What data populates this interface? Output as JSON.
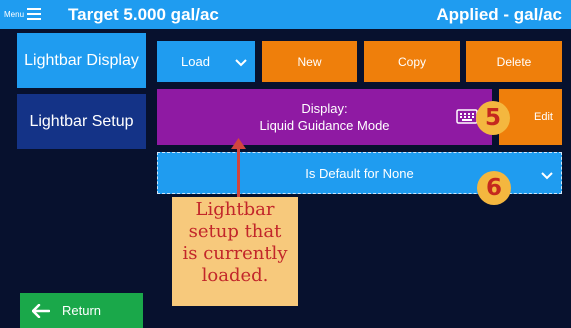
{
  "header": {
    "menu_label": "Menu",
    "target": "Target 5.000 gal/ac",
    "applied": "Applied - gal/ac"
  },
  "sidebar": {
    "items": [
      {
        "label": "Lightbar Display",
        "active": true
      },
      {
        "label": "Lightbar Setup",
        "active": false
      }
    ],
    "return_label": "Return"
  },
  "toolbar": {
    "load_label": "Load",
    "new_label": "New",
    "copy_label": "Copy",
    "delete_label": "Delete"
  },
  "display": {
    "title": "Display:",
    "mode": "Liquid Guidance Mode",
    "edit_label": "Edit"
  },
  "default_select": {
    "value": "Is Default for None"
  },
  "badges": {
    "five": "5",
    "six": "6"
  },
  "annotation": {
    "lines": [
      "Lightbar",
      "setup that",
      "is currently",
      "loaded."
    ]
  },
  "colors": {
    "background": "#07112e",
    "header": "#1f9cf0",
    "primary_blue": "#1f9cf0",
    "dark_blue": "#143387",
    "orange": "#ef7f0b",
    "purple": "#8f1aa3",
    "green": "#1aa84a",
    "badge": "#f4b73f",
    "annotation_fill": "#f7c97c",
    "annotation_text": "#c2262a"
  },
  "icons": {
    "menu": "hamburger-icon",
    "dropdown": "chevron-down-icon",
    "keyboard": "keyboard-icon",
    "return": "arrow-left-icon"
  }
}
